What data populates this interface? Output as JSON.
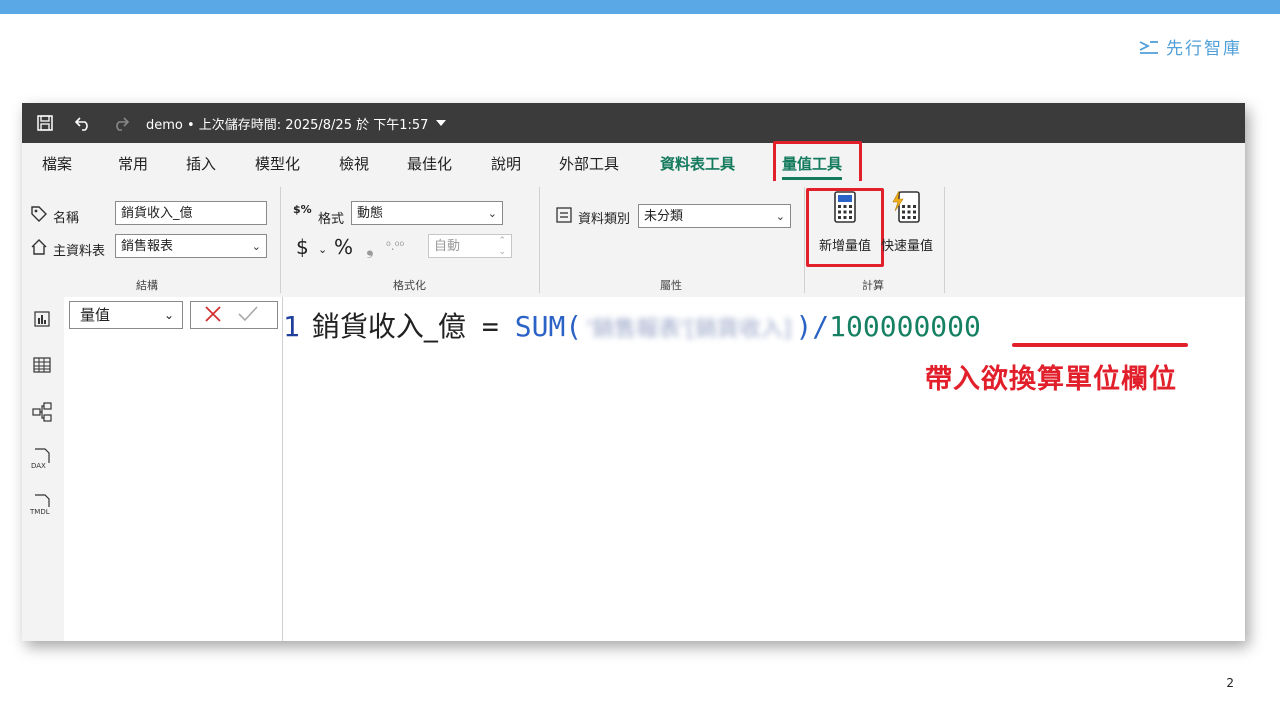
{
  "slide": {
    "brand_name": "先行智庫",
    "page_number": "2",
    "accent_color": "#5aa8e6"
  },
  "titlebar": {
    "title": "demo • 上次儲存時間: 2025/8/25 於 下午1:57"
  },
  "tabs": [
    "檔案",
    "常用",
    "插入",
    "模型化",
    "檢視",
    "最佳化",
    "說明",
    "外部工具",
    "資料表工具",
    "量值工具"
  ],
  "ribbon": {
    "structure": {
      "name_label": "名稱",
      "name_value": "銷貨收入_億",
      "home_table_label": "主資料表",
      "home_table_value": "銷售報表",
      "group_label": "結構"
    },
    "formatting": {
      "format_label": "格式",
      "format_value": "動態",
      "currency_symbol": "$",
      "percent_symbol": "%",
      "comma_symbol": "❟",
      "decimals_symbol": "⁰.⁰⁰",
      "auto_value": "自動",
      "group_label": "格式化"
    },
    "properties": {
      "data_category_label": "資料類別",
      "data_category_value": "未分類",
      "group_label": "屬性"
    },
    "calculations": {
      "new_measure_label": "新增量值",
      "quick_measure_label": "快速量值",
      "group_label": "計算"
    }
  },
  "formula_bar": {
    "field_selector": "量值",
    "line_number": "1",
    "measure_name": "銷貨收入_億",
    "equals": "=",
    "function_name": "SUM(",
    "blurred_argument": "'銷售報表'[銷貨收入]",
    "close_paren_divide": ")/",
    "divisor": "100000000"
  },
  "annotation": "帶入欲換算單位欄位",
  "highlight_color": "#e2202c",
  "context_tab_color": "#137a5c"
}
